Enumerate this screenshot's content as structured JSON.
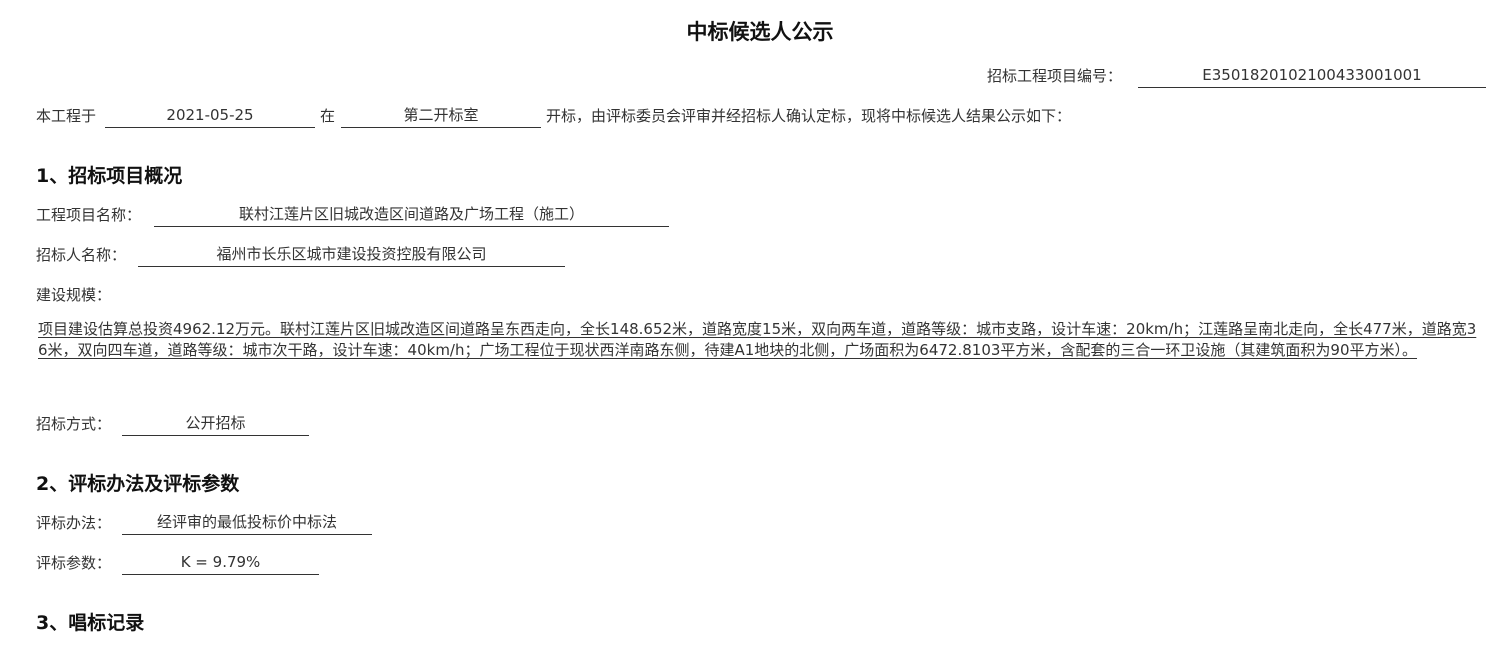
{
  "page": {
    "title": "中标候选人公示"
  },
  "header": {
    "project_code_label": "招标工程项目编号：",
    "project_code": "E3501820102100433001001"
  },
  "intro": {
    "prefix": "本工程于",
    "date": "2021-05-25",
    "at": "在",
    "room": "第二开标室",
    "suffix": "开标，由评标委员会评审并经招标人确认定标，现将中标候选人结果公示如下："
  },
  "section1": {
    "heading": "1、招标项目概况",
    "project_name_label": "工程项目名称：",
    "project_name": "联村江莲片区旧城改造区间道路及广场工程（施工）",
    "tenderer_label": "招标人名称：",
    "tenderer": "福州市长乐区城市建设投资控股有限公司",
    "scale_label": "建设规模：",
    "scale_text": "项目建设估算总投资4962.12万元。联村江莲片区旧城改造区间道路呈东西走向，全长148.652米，道路宽度15米，双向两车道，道路等级：城市支路，设计车速：20km/h；江莲路呈南北走向，全长477米，道路宽36米，双向四车道，道路等级：城市次干路，设计车速：40km/h；广场工程位于现状西洋南路东侧，待建A1地块的北侧，广场面积为6472.8103平方米，含配套的三合一环卫设施（其建筑面积为90平方米）。",
    "method_label": "招标方式：",
    "method": "公开招标"
  },
  "section2": {
    "heading": "2、评标办法及评标参数",
    "eval_method_label": "评标办法：",
    "eval_method": "经评审的最低投标价中标法",
    "eval_param_label": "评标参数：",
    "eval_param": "K = 9.79%"
  },
  "section3": {
    "heading": "3、唱标记录"
  }
}
